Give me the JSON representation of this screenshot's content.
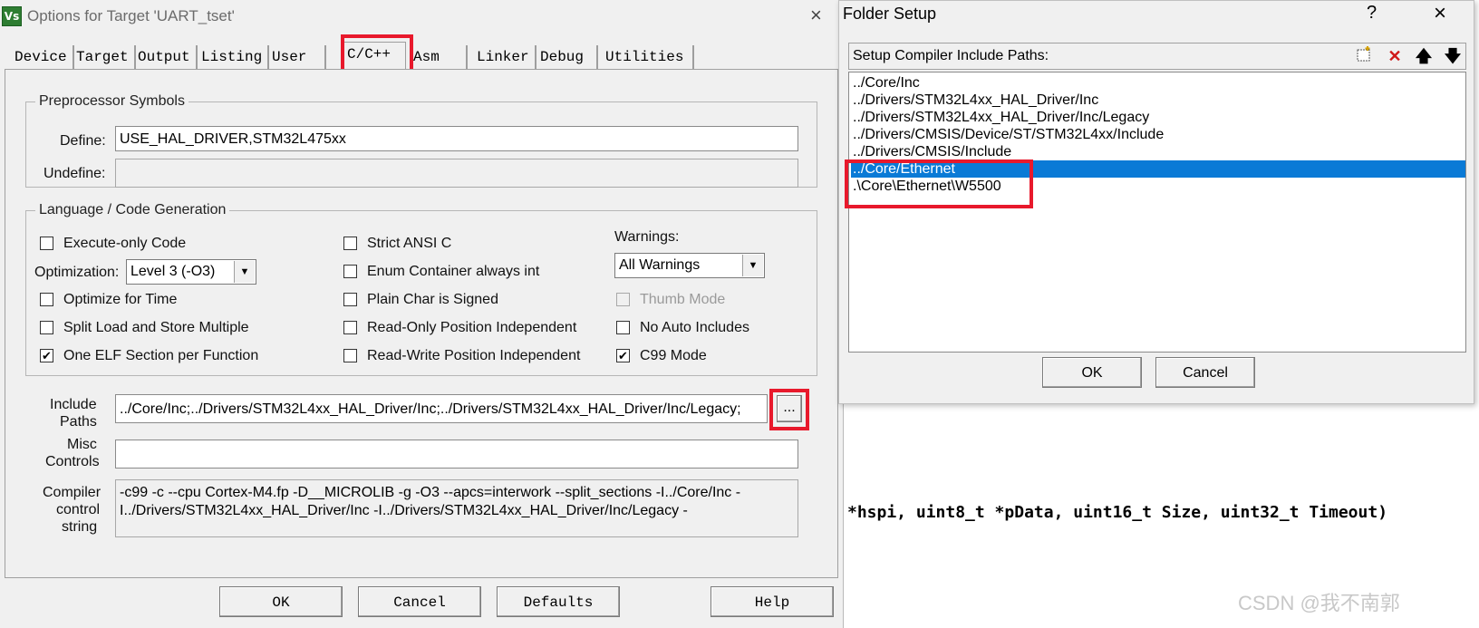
{
  "main_dialog": {
    "title": "Options for Target 'UART_tset'",
    "app_icon": "Vs",
    "close_icon": "×",
    "tabs": [
      "Device",
      "Target",
      "Output",
      "Listing",
      "User",
      "C/C++",
      "Asm",
      "Linker",
      "Debug",
      "Utilities"
    ],
    "active_tab": "C/C++",
    "preprocessor": {
      "legend": "Preprocessor Symbols",
      "define_label": "Define:",
      "define_value": "USE_HAL_DRIVER,STM32L475xx",
      "undefine_label": "Undefine:",
      "undefine_value": ""
    },
    "language": {
      "legend": "Language / Code Generation",
      "execute_only": {
        "label": "Execute-only Code",
        "checked": false
      },
      "optimization_label": "Optimization:",
      "optimization_value": "Level 3 (-O3)",
      "optimize_time": {
        "label": "Optimize for Time",
        "checked": false
      },
      "split_load": {
        "label": "Split Load and Store Multiple",
        "checked": false
      },
      "one_elf": {
        "label": "One ELF Section per Function",
        "checked": true
      },
      "strict_ansi": {
        "label": "Strict ANSI C",
        "checked": false
      },
      "enum_container": {
        "label": "Enum Container always int",
        "checked": false
      },
      "plain_char": {
        "label": "Plain Char is Signed",
        "checked": false
      },
      "ro_pi": {
        "label": "Read-Only Position Independent",
        "checked": false
      },
      "rw_pi": {
        "label": "Read-Write Position Independent",
        "checked": false
      },
      "warnings_label": "Warnings:",
      "warnings_value": "All Warnings",
      "thumb_mode": {
        "label": "Thumb Mode",
        "checked": false,
        "disabled": true
      },
      "no_auto_includes": {
        "label": "No Auto Includes",
        "checked": false
      },
      "c99_mode": {
        "label": "C99 Mode",
        "checked": true
      }
    },
    "include_paths_label_1": "Include",
    "include_paths_label_2": "Paths",
    "include_paths_value": "../Core/Inc;../Drivers/STM32L4xx_HAL_Driver/Inc;../Drivers/STM32L4xx_HAL_Driver/Inc/Legacy;",
    "browse_button": "...",
    "misc_label_1": "Misc",
    "misc_label_2": "Controls",
    "misc_value": "",
    "compiler_label_1": "Compiler",
    "compiler_label_2": "control",
    "compiler_label_3": "string",
    "compiler_line_1": "-c99 -c --cpu Cortex-M4.fp -D__MICROLIB -g -O3 --apcs=interwork --split_sections -I../Core/Inc -",
    "compiler_line_2": "I../Drivers/STM32L4xx_HAL_Driver/Inc -I../Drivers/STM32L4xx_HAL_Driver/Inc/Legacy -",
    "buttons": {
      "ok": "OK",
      "cancel": "Cancel",
      "defaults": "Defaults",
      "help": "Help"
    }
  },
  "folder_dialog": {
    "title": "Folder Setup",
    "help": "?",
    "close_icon": "×",
    "toolbar_label": "Setup Compiler Include Paths:",
    "toolbar_icons": [
      "new-folder-icon",
      "delete-icon",
      "move-up-icon",
      "move-down-icon"
    ],
    "paths": [
      "../Core/Inc",
      "../Drivers/STM32L4xx_HAL_Driver/Inc",
      "../Drivers/STM32L4xx_HAL_Driver/Inc/Legacy",
      "../Drivers/CMSIS/Device/ST/STM32L4xx/Include",
      "../Drivers/CMSIS/Include",
      "../Core/Ethernet",
      ".\\Core\\Ethernet\\W5500"
    ],
    "selected_index": 5,
    "buttons": {
      "ok": "OK",
      "cancel": "Cancel"
    }
  },
  "background_code": "*hspi, uint8_t *pData, uint16_t Size, uint32_t Timeout)",
  "watermark": "CSDN @我不南郭",
  "colors": {
    "highlight": "#e8192c",
    "selection": "#0a7ad6"
  }
}
